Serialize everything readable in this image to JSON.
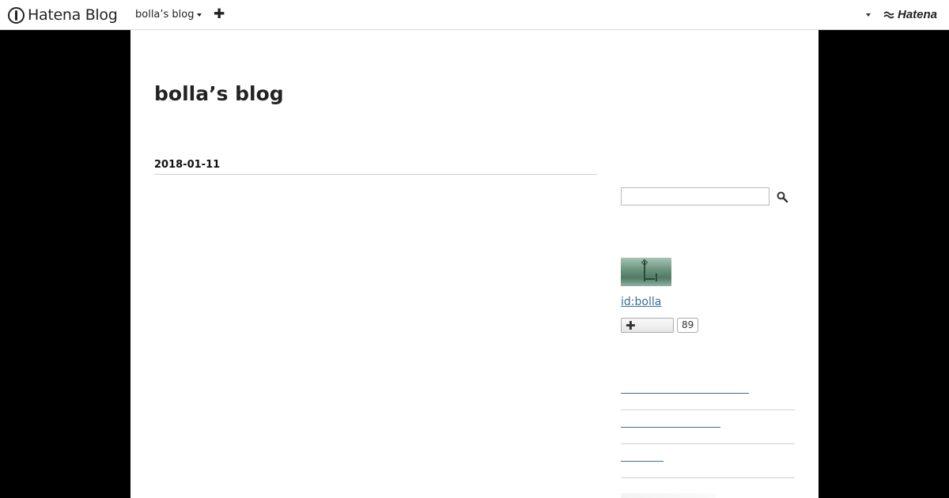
{
  "header": {
    "logo_text": "Hatena Blog",
    "blog_switch_label": "bolla’s blog",
    "add_symbol": "✚",
    "brand_text": "Hatena"
  },
  "blog": {
    "title": "bolla’s blog"
  },
  "entry": {
    "date": "2018-01-11"
  },
  "sidebar": {
    "search": {
      "placeholder": "",
      "value": ""
    },
    "profile": {
      "id_label": "id:bolla",
      "subscribe_symbol": "✚",
      "subscriber_count": "89"
    },
    "links": [
      "",
      "",
      ""
    ]
  }
}
